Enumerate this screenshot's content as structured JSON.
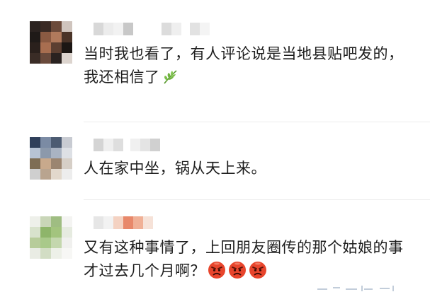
{
  "comments": [
    {
      "text_line1": "当时我也看了，有人评论说是当地县贴吧发的，",
      "text_line2": "我还相信了",
      "emoji": "leaf-icon"
    },
    {
      "text_line1": "人在家中坐，锅从天上来。"
    },
    {
      "text_line1": "又有这种事情了，上回朋友圈传的那个姑娘的事",
      "text_line2": "才过去几个月啊？",
      "emoji": "angry-face-icon"
    }
  ],
  "colors": {
    "text": "#1d1d1d",
    "divider": "#ececec",
    "leaf": "#6fb23e",
    "angry_face": "#e8452c"
  }
}
